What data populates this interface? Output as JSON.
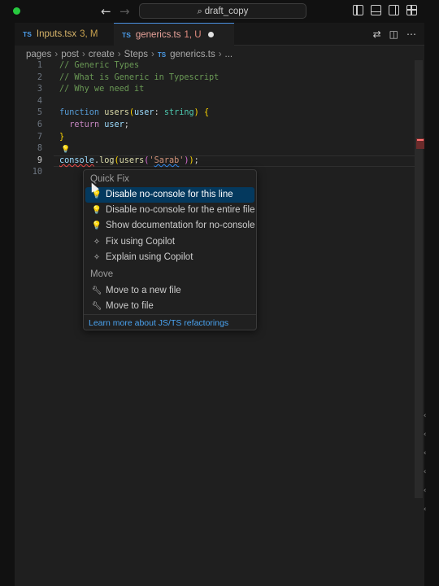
{
  "titlebar": {
    "search_text": "draft_copy",
    "back_icon": "arrow-left-icon",
    "forward_icon": "arrow-right-icon",
    "layout_icons": [
      "toggle-primary-sidebar-icon",
      "toggle-panel-icon",
      "toggle-secondary-sidebar-icon",
      "customize-layout-icon"
    ]
  },
  "tabs": [
    {
      "badge": "TS",
      "label": "Inputs.tsx",
      "status": "3, M",
      "active": false
    },
    {
      "badge": "TS",
      "label": "generics.ts",
      "status": "1, U",
      "active": true,
      "dirty": true
    }
  ],
  "tab_actions": [
    "compare-changes-icon",
    "split-editor-icon",
    "more-actions-icon"
  ],
  "breadcrumb": {
    "parts": [
      "pages",
      "post",
      "create",
      "Steps"
    ],
    "file_badge": "TS",
    "file": "generics.ts",
    "tail": "..."
  },
  "editor": {
    "current_line": 9,
    "lines": [
      {
        "n": "1",
        "text": "// Generic Types"
      },
      {
        "n": "2",
        "text": "// What is Generic in Typescript"
      },
      {
        "n": "3",
        "text": "// Why we need it"
      },
      {
        "n": "4",
        "text": ""
      },
      {
        "n": "5",
        "text": "function users(user: string) {"
      },
      {
        "n": "6",
        "text": "  return user;"
      },
      {
        "n": "7",
        "text": "}"
      },
      {
        "n": "8",
        "text": ""
      },
      {
        "n": "9",
        "text": "console.log(users('Sarab'));"
      },
      {
        "n": "10",
        "text": ""
      }
    ],
    "tokens": {
      "l1": "// Generic Types",
      "l2": "// What is Generic in Typescript",
      "l3": "// Why we need it",
      "l5_kw": "function",
      "l5_fn": "users",
      "l5_p1": "(",
      "l5_param": "user",
      "l5_colon": ": ",
      "l5_type": "string",
      "l5_p2": ") ",
      "l5_brace": "{",
      "l6_kw": "return",
      "l6_id": "user",
      "l6_semi": ";",
      "l7_brace": "}",
      "l9_console": "console",
      "l9_dot": ".",
      "l9_log": "log",
      "l9_p1": "(",
      "l9_users": "users",
      "l9_p2": "(",
      "l9_q1": "'",
      "l9_str": "Sarab",
      "l9_q2": "'",
      "l9_p3": ")",
      "l9_p4": ")",
      "l9_semi": ";"
    },
    "lightbulb_icon": "lightbulb-icon"
  },
  "quick_fix": {
    "header_quick_fix": "Quick Fix",
    "header_move": "Move",
    "items": [
      {
        "label": "Disable no-console for this line",
        "icon": "lightbulb-icon",
        "selected": true
      },
      {
        "label": "Disable no-console for the entire file",
        "icon": "lightbulb-icon"
      },
      {
        "label": "Show documentation for no-console",
        "icon": "lightbulb-icon"
      },
      {
        "label": "Fix using Copilot",
        "icon": "sparkle-icon"
      },
      {
        "label": "Explain using Copilot",
        "icon": "sparkle-icon"
      },
      {
        "label": "Move to a new file",
        "icon": "wrench-icon"
      },
      {
        "label": "Move to file",
        "icon": "wrench-icon"
      }
    ],
    "footer_link": "Learn more about JS/TS refactorings"
  },
  "colors": {
    "accent": "#04395e",
    "link": "#4aa3f0",
    "error": "#f14c4c",
    "modified": "#d7b46a",
    "untracked": "#e8a39a"
  }
}
